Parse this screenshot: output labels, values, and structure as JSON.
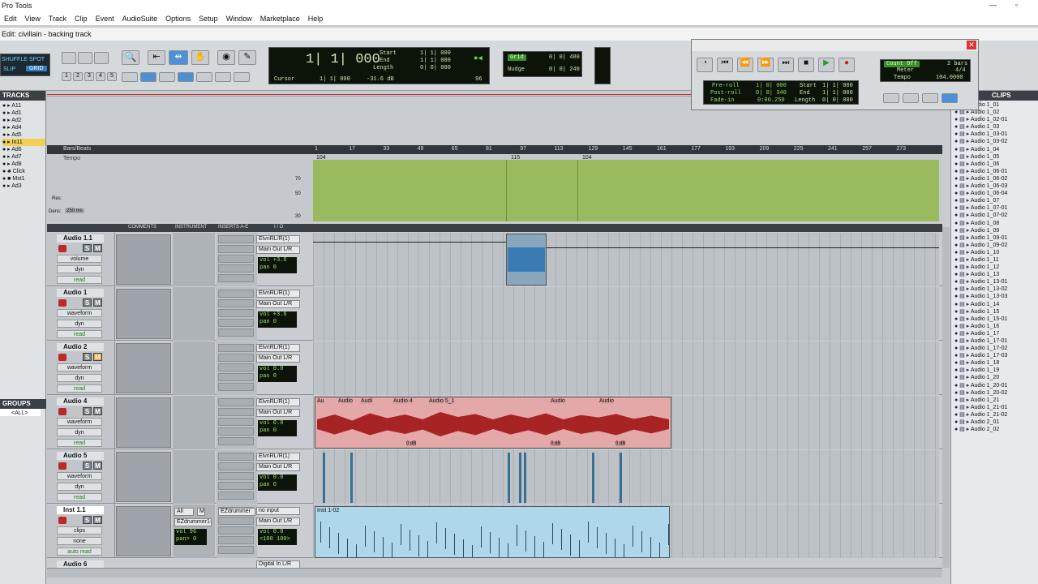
{
  "app": {
    "title": "Pro Tools",
    "window_title": "Edit: civillain - backing track"
  },
  "menu": [
    "Edit",
    "View",
    "Track",
    "Clip",
    "Event",
    "AudioSuite",
    "Options",
    "Setup",
    "Window",
    "Marketplace",
    "Help"
  ],
  "modes": {
    "shuffle": "SHUFFLE",
    "spot": "SPOT",
    "slip": "SLIP",
    "grid": "GRID"
  },
  "zoom_presets": [
    "1",
    "2",
    "3",
    "4",
    "5"
  ],
  "counter": {
    "main": "1| 1| 000",
    "start_label": "Start",
    "end_label": "End",
    "length_label": "Length",
    "start": "1| 1| 000",
    "end": "1| 1| 000",
    "length": "0| 0| 000",
    "cursor_label": "Cursor",
    "cursor": "1| 1| 000",
    "db": "-31.6 dB",
    "bpm": "96"
  },
  "grid_nudge": {
    "grid_label": "Grid",
    "grid": "0| 0| 480",
    "nudge_label": "Nudge",
    "nudge": "0| 0| 240"
  },
  "transport": {
    "preroll_label": "Pre-roll",
    "postroll_label": "Post-roll",
    "fadein_label": "Fade-in",
    "preroll": "1| 0| 000",
    "postroll": "0| 0| 340",
    "fadein": "0:00.250",
    "start_label": "Start",
    "end_label": "End",
    "length_label": "Length",
    "start": "1| 1| 000",
    "end": "1| 1| 000",
    "length": "0| 0| 000",
    "countoff": "Count Off",
    "bars": "2 bars",
    "meter_label": "Meter",
    "meter": "4/4",
    "tempo_label": "Tempo",
    "tempo": "104.0000"
  },
  "tracks_panel": {
    "title": "TRACKS",
    "items": [
      "A11",
      "Ad1",
      "Ad2",
      "Ad4",
      "Ad5",
      "In11",
      "Ad6",
      "Ad7",
      "Ad8",
      "Click",
      "Mst1",
      "Ad3"
    ]
  },
  "groups_panel": {
    "title": "GROUPS",
    "all": "<ALL>"
  },
  "clips_panel": {
    "title": "CLIPS",
    "items": [
      "Audio 1_01",
      "Audio 1_02",
      "Audio 1_02-01",
      "Audio 1_03",
      "Audio 1_03-01",
      "Audio 1_03-02",
      "Audio 1_04",
      "Audio 1_05",
      "Audio 1_06",
      "Audio 1_06-01",
      "Audio 1_06-02",
      "Audio 1_06-03",
      "Audio 1_06-04",
      "Audio 1_07",
      "Audio 1_07-01",
      "Audio 1_07-02",
      "Audio 1_08",
      "Audio 1_09",
      "Audio 1_09-01",
      "Audio 1_09-02",
      "Audio 1_10",
      "Audio 1_11",
      "Audio 1_12",
      "Audio 1_13",
      "Audio 1_13-01",
      "Audio 1_13-02",
      "Audio 1_13-03",
      "Audio 1_14",
      "Audio 1_15",
      "Audio 1_15-01",
      "Audio 1_16",
      "Audio 1_17",
      "Audio 1_17-01",
      "Audio 1_17-02",
      "Audio 1_17-03",
      "Audio 1_18",
      "Audio 1_19",
      "Audio 1_20",
      "Audio 1_20-01",
      "Audio 1_20-02",
      "Audio 1_21",
      "Audio 1_21-01",
      "Audio 1_21-02",
      "Audio 2_01",
      "Audio 2_02"
    ]
  },
  "ruler": {
    "bars_label": "Bars/Beats",
    "tempo_label": "Tempo",
    "ticks": [
      "1",
      "17",
      "33",
      "49",
      "65",
      "81",
      "97",
      "113",
      "129",
      "145",
      "161",
      "177",
      "193",
      "209",
      "225",
      "241",
      "257",
      "273"
    ],
    "tempo_markers": [
      "104",
      "115",
      "104"
    ],
    "axis": [
      "70",
      "50",
      "30"
    ],
    "res_label": "Res:",
    "density_label": "Dens:",
    "density": "250 ms"
  },
  "columns": {
    "comments": "COMMENTS",
    "instrument": "INSTRUMENT",
    "inserts": "INSERTS A-E",
    "io": "I / O"
  },
  "tracks": [
    {
      "name": "Audio 1.1",
      "view": "volume",
      "dyn": "dyn",
      "auto": "read",
      "input": "ElvnRL/R(1)",
      "output": "Main Out L/R",
      "vol": "vol  +3.6",
      "pan": "pan    0"
    },
    {
      "name": "Audio 1",
      "view": "waveform",
      "dyn": "dyn",
      "auto": "read",
      "input": "ElvnRL/R(1)",
      "output": "Main Out L/R",
      "vol": "vol  +3.6",
      "pan": "pan    0"
    },
    {
      "name": "Audio 2",
      "view": "waveform",
      "dyn": "dyn",
      "auto": "read",
      "input": "ElvnRL/R(1)",
      "output": "Main Out L/R",
      "vol": "vol   0.0",
      "pan": "pan    0"
    },
    {
      "name": "Audio 4",
      "view": "waveform",
      "dyn": "dyn",
      "auto": "read",
      "input": "ElvnRL/R(1)",
      "output": "Main Out L/R",
      "vol": "vol   0.0",
      "pan": "pan    0"
    },
    {
      "name": "Audio 5",
      "view": "waveform",
      "dyn": "dyn",
      "auto": "read",
      "input": "ElvnRL/R(1)",
      "output": "Main Out L/R",
      "vol": "vol   0.0",
      "pan": "pan    0"
    },
    {
      "name": "Inst 1.1",
      "view": "clips",
      "dyn": "none",
      "auto": "auto read",
      "input": "no input",
      "output": "Main Out L/R",
      "vol": "vol   0.0",
      "pan": "<100  100>"
    }
  ],
  "inst_track": {
    "inst_all": "All",
    "inst_m": "M",
    "plugin": "EZdrummer",
    "plugin2": "EZdrummer1-1",
    "inst_vol": "vol   96",
    "inst_pan": "pan>  0"
  },
  "partial_track": {
    "name": "Audio 6",
    "input": "Digital In L/R"
  },
  "clip_labels": {
    "audio4": [
      "Au",
      "Audio",
      "Audi",
      "Audio 4",
      "Audio 5_1",
      "Audio",
      "Audio"
    ],
    "gain": "0 dB",
    "inst": "Inst 1-02"
  }
}
